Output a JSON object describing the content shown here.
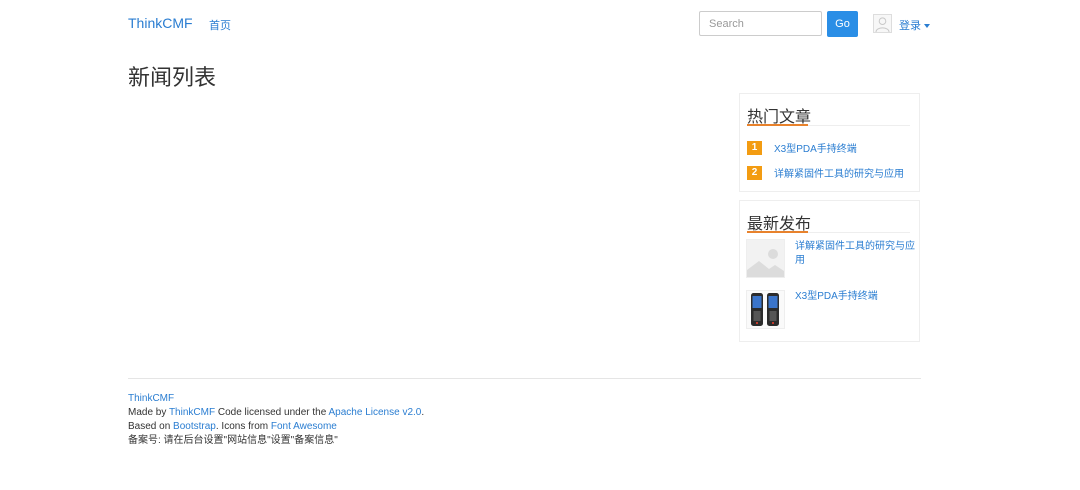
{
  "header": {
    "brand": "ThinkCMF",
    "nav_home": "首页",
    "search_placeholder": "Search",
    "go_label": "Go",
    "login_label": "登录"
  },
  "page": {
    "title": "新闻列表"
  },
  "sidebar": {
    "hot": {
      "title": "热门文章",
      "items": [
        {
          "rank": "1",
          "title": "X3型PDA手持终端"
        },
        {
          "rank": "2",
          "title": "详解紧固件工具的研究与应用"
        }
      ]
    },
    "latest": {
      "title": "最新发布",
      "items": [
        {
          "title": "详解紧固件工具的研究与应用"
        },
        {
          "title": "X3型PDA手持终端"
        }
      ]
    }
  },
  "footer": {
    "brand": "ThinkCMF",
    "made_by_prefix": "Made by ",
    "made_by_link": "ThinkCMF",
    "license_text": " Code licensed under the ",
    "license_link": "Apache License v2.0",
    "license_end": ".",
    "based_on_prefix": "Based on ",
    "bootstrap_link": "Bootstrap",
    "icons_text": ". Icons from ",
    "fontawesome_link": "Font Awesome",
    "icp": "备案号: 请在后台设置\"网站信息\"设置\"备案信息\""
  },
  "colors": {
    "link": "#2a7dd1",
    "button": "#2a8ee6",
    "rank_badge": "#f39c12",
    "title_accent": "#e8822c"
  },
  "icons": {
    "avatar": "user-avatar-icon",
    "caret": "caret-down-icon",
    "placeholder_thumb": "image-placeholder-icon",
    "pda_thumb": "pda-device-image"
  }
}
